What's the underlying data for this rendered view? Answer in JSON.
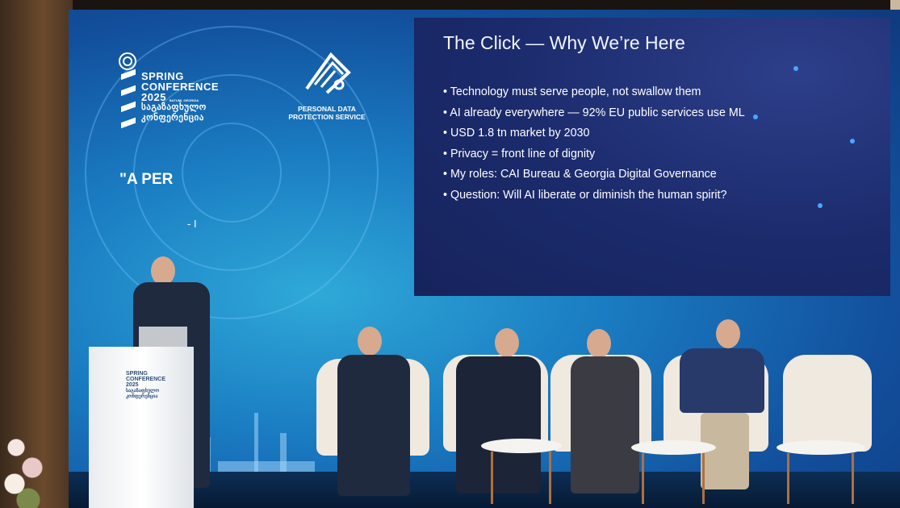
{
  "slide": {
    "title": "The Click — Why We’re Here",
    "bullets": [
      "Technology must serve people, not swallow them",
      "AI already everywhere — 92% EU public services use ML",
      "USD 1.8 tn market by 2030",
      "Privacy = front line of dignity",
      "My roles: CAI Bureau & Georgia Digital Governance",
      "Question: Will AI liberate or diminish the human spirit?"
    ]
  },
  "conference_logo": {
    "line1": "SPRING",
    "line2": "CONFERENCE",
    "year": "2025",
    "location": "BATUMI, GEORGIA",
    "georgian_line1": "საგაზაფხულო",
    "georgian_line2": "კონფერენცია"
  },
  "pdps_logo": {
    "line1": "PERSONAL DATA",
    "line2": "PROTECTION SERVICE"
  },
  "quote": {
    "text": "\"A PER",
    "attribution": "- I"
  },
  "lectern_logo": {
    "line1": "SPRING",
    "line2": "CONFERENCE",
    "year": "2025",
    "georgian_line1": "საგაზაფხულო",
    "georgian_line2": "კონფერენცია"
  },
  "colors": {
    "screen_blue": "#1a7cc2",
    "slide_navy": "#1b2a6b",
    "slide_text": "#ffffff",
    "chair_cream": "#efe9df"
  }
}
